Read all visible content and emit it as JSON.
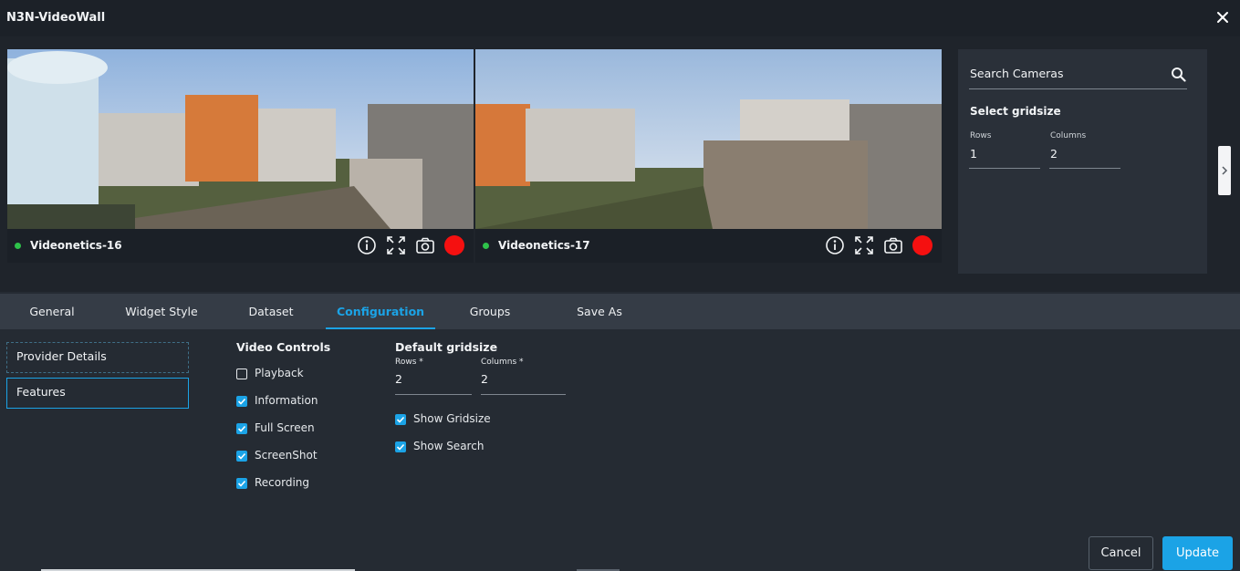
{
  "window": {
    "title": "N3N-VideoWall"
  },
  "cameras": [
    {
      "name": "Videonetics-16",
      "status": "online"
    },
    {
      "name": "Videonetics-17",
      "status": "online"
    }
  ],
  "camera_controls": [
    "info-icon",
    "fullscreen-icon",
    "camera-icon",
    "record-icon"
  ],
  "side_panel": {
    "search_label": "Search Cameras",
    "gridsize_heading": "Select gridsize",
    "rows_label": "Rows",
    "rows_value": "1",
    "columns_label": "Columns",
    "columns_value": "2"
  },
  "tabs": [
    {
      "label": "General"
    },
    {
      "label": "Widget Style"
    },
    {
      "label": "Dataset"
    },
    {
      "label": "Configuration",
      "active": true
    },
    {
      "label": "Groups"
    },
    {
      "label": "Save As"
    }
  ],
  "left_nav": [
    {
      "label": "Provider Details"
    },
    {
      "label": "Features",
      "selected": true
    }
  ],
  "video_controls": {
    "title": "Video Controls",
    "items": [
      {
        "label": "Playback",
        "checked": false
      },
      {
        "label": "Information",
        "checked": true
      },
      {
        "label": "Full Screen",
        "checked": true
      },
      {
        "label": "ScreenShot",
        "checked": true
      },
      {
        "label": "Recording",
        "checked": true
      }
    ]
  },
  "default_gridsize": {
    "title": "Default gridsize",
    "rows_label": "Rows *",
    "rows_value": "2",
    "columns_label": "Columns *",
    "columns_value": "2",
    "options": [
      {
        "label": "Show Gridsize",
        "checked": true
      },
      {
        "label": "Show Search",
        "checked": true
      }
    ]
  },
  "footer": {
    "cancel_label": "Cancel",
    "update_label": "Update"
  },
  "colors": {
    "accent": "#1ba3e6",
    "online": "#2ec24a",
    "record": "#f51010",
    "background": "#252b33"
  }
}
